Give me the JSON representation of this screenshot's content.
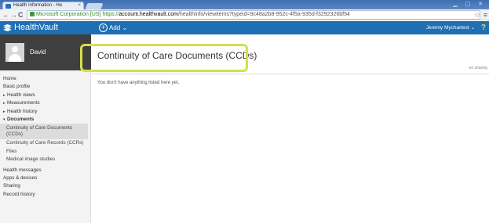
{
  "browser": {
    "tab_title": "Health Information - He",
    "tab_close": "×",
    "back": "←",
    "forward": "→",
    "reload": "C",
    "url_ev": "Microsoft Corporation [US]",
    "url_scheme": "https://",
    "url_host": "account.healthvault.com",
    "url_path": "/healthinfo/viewitems?typeid=9c48a2b8-952c-4f5a-935d-f3292326bf54",
    "star": "☆",
    "menu": "≡"
  },
  "header": {
    "logo": "HealthVault",
    "add_plus": "+",
    "add_label": "Add",
    "add_caret": "⌄",
    "user": "Jeremy Mychartest",
    "user_caret": "⌄",
    "help": "?"
  },
  "profile": {
    "name": "David"
  },
  "nav": {
    "items": [
      {
        "label": "Home"
      },
      {
        "label": "Basic profile"
      },
      {
        "label": "Health views",
        "caret": "▸"
      },
      {
        "label": "Measurements",
        "caret": "▸"
      },
      {
        "label": "Health history",
        "caret": "▸"
      },
      {
        "label": "Documents",
        "caret": "▾"
      },
      {
        "label": "Continuity of Care Documents (CCDs)"
      },
      {
        "label": "Continuity of Care Records (CCRs)"
      },
      {
        "label": "Files"
      },
      {
        "label": "Medical image studies"
      },
      {
        "label": "Health messages"
      },
      {
        "label": "Apps & devices"
      },
      {
        "label": "Sharing"
      },
      {
        "label": "Record history"
      }
    ]
  },
  "main": {
    "title": "Continuity of Care Documents (CCDs)",
    "share": "ee sharing",
    "empty_message": "You don't have anything listed here yet."
  },
  "colors": {
    "brand": "#1f6fb4",
    "highlight": "#d4e04a",
    "sidebar_profile": "#3f3f3f"
  }
}
